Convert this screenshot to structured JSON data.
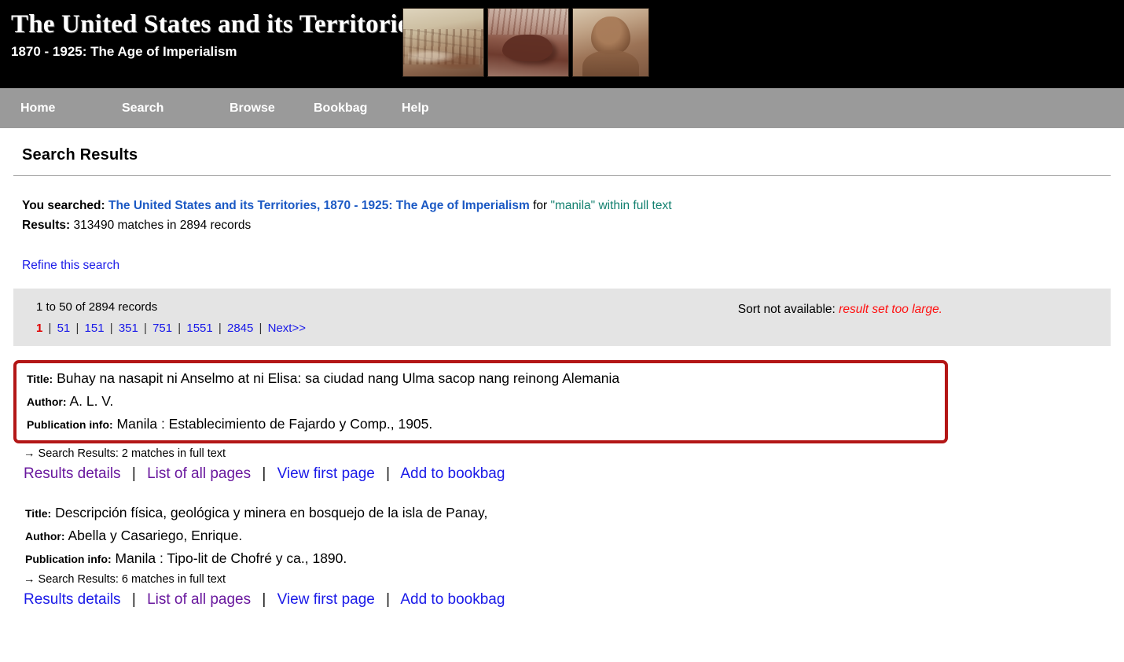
{
  "banner": {
    "title": "The United States and its Territories",
    "subtitle": "1870 - 1925: The Age of Imperialism",
    "photos": [
      {
        "name": "soldiers-in-field-photo"
      },
      {
        "name": "water-buffalo-photo"
      },
      {
        "name": "portrait-of-man-photo"
      }
    ]
  },
  "nav": {
    "items": [
      {
        "label": "Home"
      },
      {
        "label": "Search"
      },
      {
        "label": "Browse"
      },
      {
        "label": "Bookbag"
      },
      {
        "label": "Help"
      }
    ]
  },
  "page": {
    "title": "Search Results"
  },
  "search_summary": {
    "you_searched_label": "You searched:",
    "collection": "The United States and its Territories, 1870 - 1925: The Age of Imperialism",
    "for_word": "for",
    "query": "\"manila\"",
    "scope": "within full text",
    "results_label": "Results:",
    "results_text": "313490 matches in 2894 records",
    "refine_link": "Refine this search"
  },
  "results_nav": {
    "range_text": "1 to 50 of 2894 records",
    "current_page": "1",
    "pages": [
      "51",
      "151",
      "351",
      "751",
      "1551",
      "2845",
      "Next>>"
    ],
    "separator": "|",
    "sort_label": "Sort not available:",
    "sort_note": "result set too large."
  },
  "records": [
    {
      "highlighted": true,
      "title_label": "Title:",
      "title": "Buhay na nasapit ni Anselmo at ni Elisa: sa ciudad nang Ulma sacop nang reinong Alemania",
      "author_label": "Author:",
      "author": "A. L. V.",
      "pub_label": "Publication info:",
      "pub": "Manila : Establecimiento de Fajardo y Comp., 1905.",
      "matches": "→ Search Results: 2 matches in full text",
      "actions": [
        {
          "label": "Results details",
          "state": "visited"
        },
        {
          "label": "List of all pages",
          "state": "visited"
        },
        {
          "label": "View first page",
          "state": "link"
        },
        {
          "label": "Add to bookbag",
          "state": "link"
        }
      ]
    },
    {
      "highlighted": false,
      "title_label": "Title:",
      "title": "Descripción física, geológica y minera en bosquejo de la isla de Panay,",
      "author_label": "Author:",
      "author": "Abella y Casariego, Enrique.",
      "pub_label": "Publication info:",
      "pub": "Manila : Tipo-lit de Chofré y ca., 1890.",
      "matches": "→ Search Results: 6 matches in full text",
      "actions": [
        {
          "label": "Results details",
          "state": "link"
        },
        {
          "label": "List of all pages",
          "state": "visited"
        },
        {
          "label": "View first page",
          "state": "link"
        },
        {
          "label": "Add to bookbag",
          "state": "link"
        }
      ]
    }
  ],
  "colors": {
    "banner_background": "#000000",
    "navbar_background": "#9a9a9a",
    "link": "#1a1ae8",
    "visited_link": "#69189e",
    "collection_link": "#1b59c4",
    "query_term": "#12806f",
    "current_page": "#e00000",
    "warning": "#ff1010",
    "results_box": "#e4e4e4",
    "highlight_border": "#b31616"
  }
}
